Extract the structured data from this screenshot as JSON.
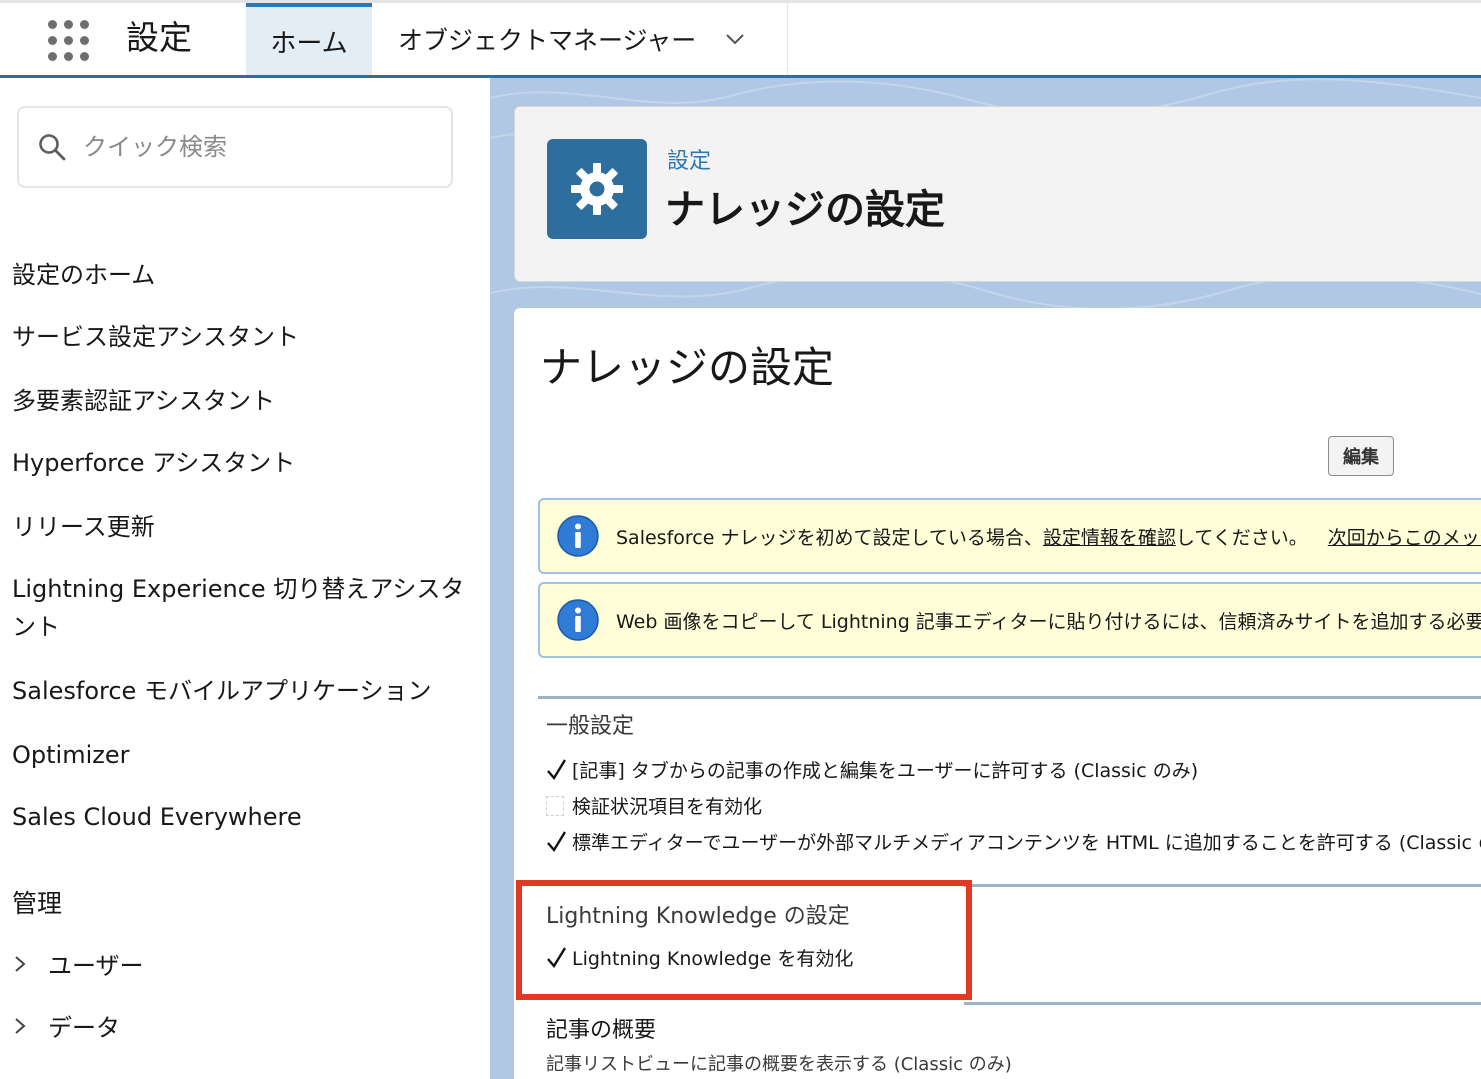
{
  "topbar": {
    "app_title": "設定",
    "tabs": [
      {
        "label": "ホーム",
        "active": true
      },
      {
        "label": "オブジェクトマネージャー",
        "has_dropdown": true
      }
    ]
  },
  "sidebar": {
    "search_placeholder": "クイック検索",
    "items": [
      {
        "label": "設定のホーム"
      },
      {
        "label": "サービス設定アシスタント"
      },
      {
        "label": "多要素認証アシスタント"
      },
      {
        "label": "Hyperforce アシスタント"
      },
      {
        "label": "リリース更新"
      },
      {
        "label": "Lightning Experience 切り替えアシスタント"
      },
      {
        "label": "Salesforce モバイルアプリケーション"
      },
      {
        "label": "Optimizer"
      },
      {
        "label": "Sales Cloud Everywhere"
      }
    ],
    "section_heading": "管理",
    "groups": [
      {
        "label": "ユーザー"
      },
      {
        "label": "データ"
      }
    ]
  },
  "header": {
    "breadcrumb": "設定",
    "title": "ナレッジの設定",
    "icon": "gear-icon"
  },
  "content": {
    "title": "ナレッジの設定",
    "edit_label": "編集",
    "info_messages": [
      {
        "prefix": "Salesforce ナレッジを初めて設定している場合、",
        "link": "設定情報を確認",
        "suffix": "してください。",
        "dismiss": "次回からこのメッセー"
      },
      {
        "text": "Web 画像をコピーして Lightning 記事エディターに貼り付けるには、信頼済みサイトを追加する必要"
      }
    ],
    "general": {
      "title": "一般設定",
      "options": [
        {
          "label": "[記事] タブからの記事の作成と編集をユーザーに許可する (Classic のみ)",
          "checked": true
        },
        {
          "label": "検証状況項目を有効化",
          "checked": false
        },
        {
          "label": "標準エディターでユーザーが外部マルチメディアコンテンツを HTML に追加することを許可する (Classic の",
          "checked": true
        }
      ]
    },
    "lightning": {
      "title": "Lightning Knowledge の設定",
      "option": {
        "label": "Lightning Knowledge を有効化",
        "checked": true
      }
    },
    "summary": {
      "title": "記事の概要",
      "text": "記事リストビューに記事の概要を表示する (Classic のみ)"
    }
  },
  "colors": {
    "brand": "#2e6e9e",
    "highlight": "#e03a22",
    "info_bg": "#fefed8"
  }
}
